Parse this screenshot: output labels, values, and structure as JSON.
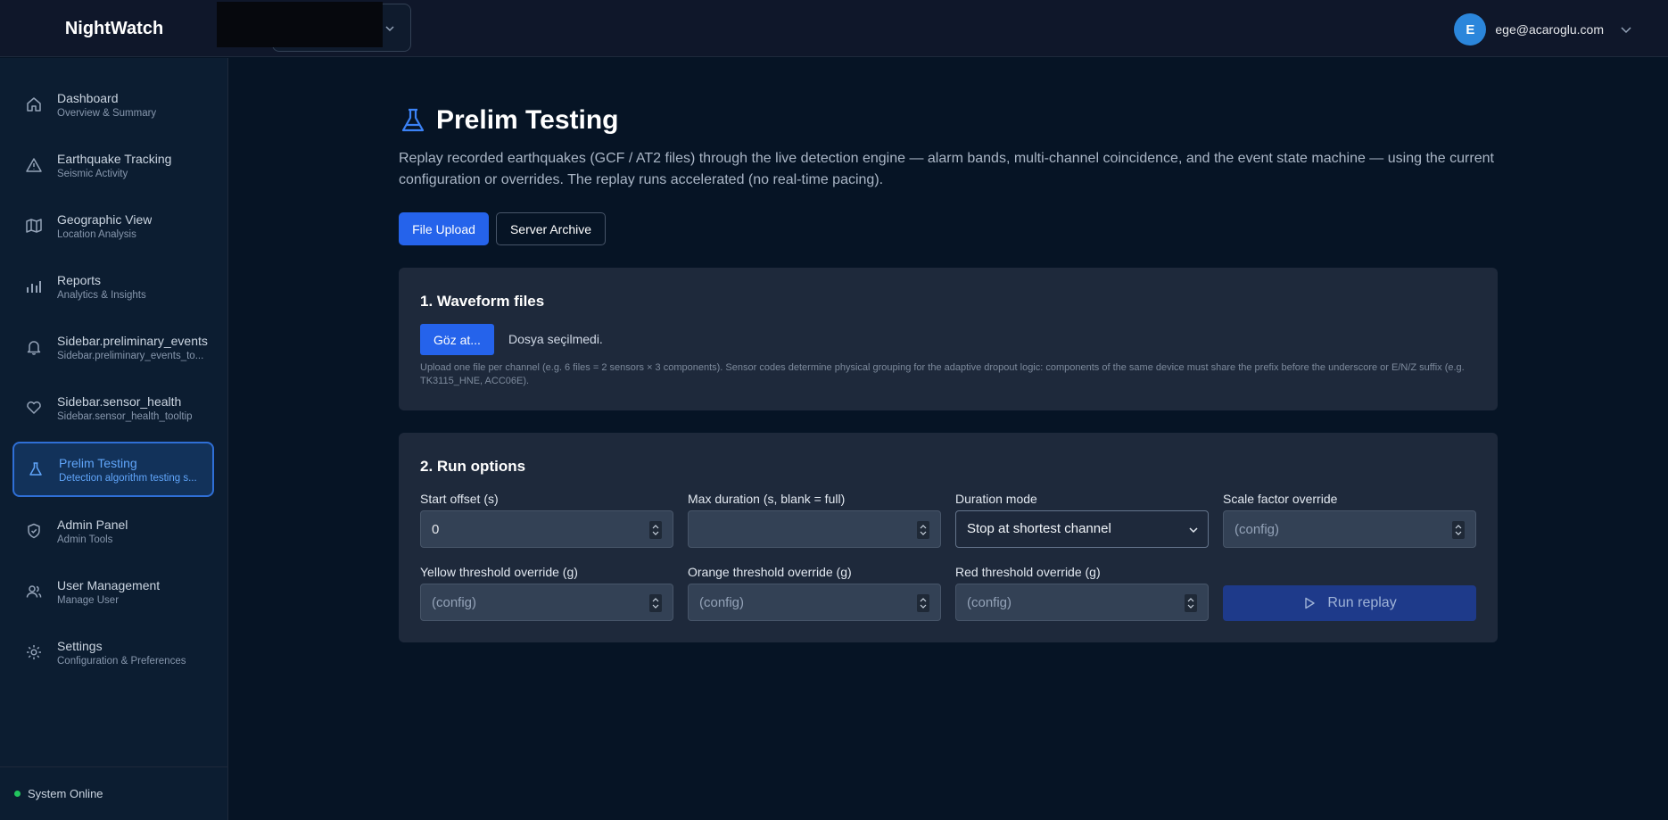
{
  "app": {
    "title": "NightWatch"
  },
  "user": {
    "initial": "E",
    "email": "ege@acaroglu.com"
  },
  "sidebar": {
    "items": [
      {
        "label": "Dashboard",
        "sub": "Overview & Summary",
        "icon": "home-icon"
      },
      {
        "label": "Earthquake Tracking",
        "sub": "Seismic Activity",
        "icon": "alert-triangle-icon"
      },
      {
        "label": "Geographic View",
        "sub": "Location Analysis",
        "icon": "map-icon"
      },
      {
        "label": "Reports",
        "sub": "Analytics & Insights",
        "icon": "bar-chart-icon"
      },
      {
        "label": "Sidebar.preliminary_events",
        "sub": "Sidebar.preliminary_events_to...",
        "icon": "bell-icon"
      },
      {
        "label": "Sidebar.sensor_health",
        "sub": "Sidebar.sensor_health_tooltip",
        "icon": "heart-icon"
      },
      {
        "label": "Prelim Testing",
        "sub": "Detection algorithm testing s...",
        "icon": "flask-icon",
        "active": true
      },
      {
        "label": "Admin Panel",
        "sub": "Admin Tools",
        "icon": "shield-check-icon"
      },
      {
        "label": "User Management",
        "sub": "Manage User",
        "icon": "users-icon"
      },
      {
        "label": "Settings",
        "sub": "Configuration & Preferences",
        "icon": "gear-icon"
      }
    ],
    "status": "System Online"
  },
  "page": {
    "title": "Prelim Testing",
    "description": "Replay recorded earthquakes (GCF / AT2 files) through the live detection engine — alarm bands, multi-channel coincidence, and the event state machine — using the current configuration or overrides. The replay runs accelerated (no real-time pacing).",
    "tabs": {
      "file_upload": "File Upload",
      "server_archive": "Server Archive"
    }
  },
  "waveform": {
    "title": "1. Waveform files",
    "browse": "Göz at...",
    "no_file": "Dosya seçilmedi.",
    "hint": "Upload one file per channel (e.g. 6 files = 2 sensors × 3 components). Sensor codes determine physical grouping for the adaptive dropout logic: components of the same device must share the prefix before the underscore or E/N/Z suffix (e.g. TK3115_HNE, ACC06E)."
  },
  "run_options": {
    "title": "2. Run options",
    "start_offset": {
      "label": "Start offset (s)",
      "value": "0"
    },
    "max_duration": {
      "label": "Max duration (s, blank = full)",
      "value": ""
    },
    "duration_mode": {
      "label": "Duration mode",
      "value": "Stop at shortest channel"
    },
    "scale_factor": {
      "label": "Scale factor override",
      "placeholder": "(config)"
    },
    "yellow": {
      "label": "Yellow threshold override (g)",
      "placeholder": "(config)"
    },
    "orange": {
      "label": "Orange threshold override (g)",
      "placeholder": "(config)"
    },
    "red": {
      "label": "Red threshold override (g)",
      "placeholder": "(config)"
    },
    "run_button": "Run replay"
  },
  "colors": {
    "accent": "#2563eb",
    "background": "#061425",
    "card": "#1e293b",
    "online": "#22c55e"
  }
}
